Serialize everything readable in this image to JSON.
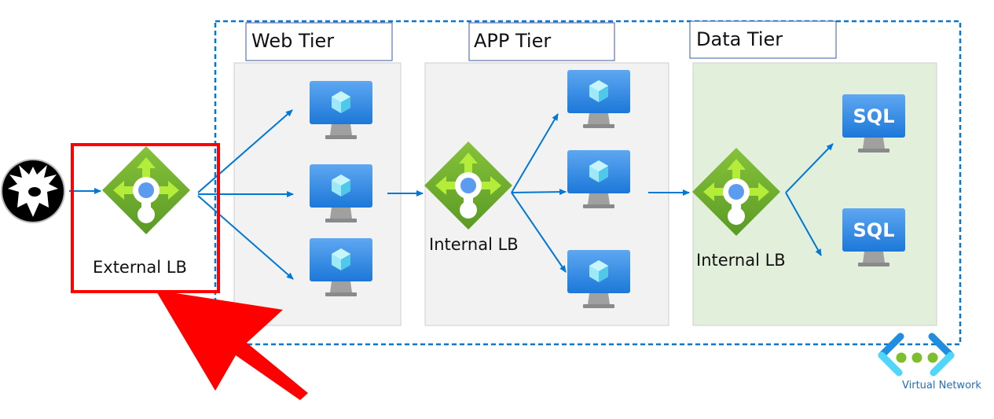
{
  "user": {
    "icon": "user-avatar-icon"
  },
  "external_lb": {
    "label": "External LB",
    "highlighted": true,
    "highlight_color": "#ff0000"
  },
  "tiers": [
    {
      "label": "Web Tier",
      "vm_count": 3,
      "panel_color": "#f2f2f2"
    },
    {
      "label": "APP Tier",
      "lb_label": "Internal LB",
      "vm_count": 3,
      "panel_color": "#f2f2f2"
    },
    {
      "label": "Data Tier",
      "lb_label": "Internal LB",
      "sql_label": "SQL",
      "vm_count": 2,
      "panel_color": "#e2efda"
    }
  ],
  "virtual_network": {
    "label": "Virtual Network"
  },
  "colors": {
    "arrow": "#0078d4",
    "lb_green": "#6fae2f",
    "vm_blue": "#2f8fe8",
    "pointer": "#ff0000"
  }
}
